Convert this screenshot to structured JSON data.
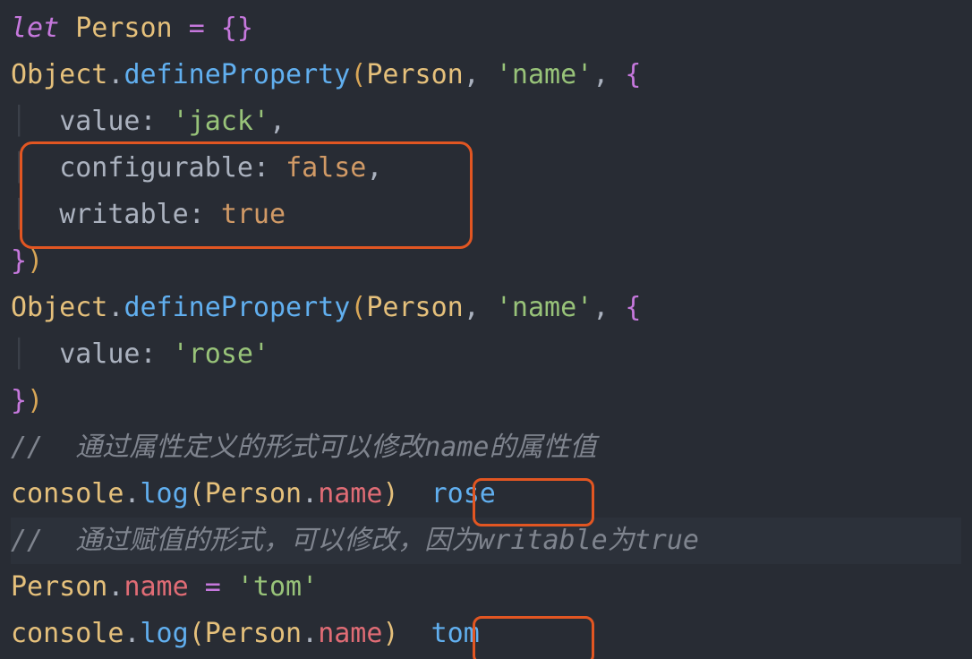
{
  "code": {
    "l1": {
      "let": "let",
      "sp1": " ",
      "Person": "Person",
      "sp2": " ",
      "eq": "=",
      "sp3": " ",
      "ob": "{}",
      "cb": ""
    },
    "l2": {
      "Object": "Object",
      "dot": ".",
      "method": "defineProperty",
      "op": "(",
      "arg1": "Person",
      "c1": ", ",
      "str": "'name'",
      "c2": ", ",
      "brace": "{"
    },
    "l3": {
      "indent": "  ",
      "key": "value",
      "colon": ": ",
      "val": "'jack'",
      "comma": ","
    },
    "l4": {
      "indent": "  ",
      "key": "configurable",
      "colon": ": ",
      "val": "false",
      "comma": ","
    },
    "l5": {
      "indent": "  ",
      "key": "writable",
      "colon": ": ",
      "val": "true"
    },
    "l6": {
      "brace": "}",
      "cp": ")"
    },
    "l7": {
      "Object": "Object",
      "dot": ".",
      "method": "defineProperty",
      "op": "(",
      "arg1": "Person",
      "c1": ", ",
      "str": "'name'",
      "c2": ", ",
      "brace": "{"
    },
    "l8": {
      "indent": "  ",
      "key": "value",
      "colon": ": ",
      "val": "'rose'"
    },
    "l9": {
      "brace": "}",
      "cp": ")"
    },
    "l10": {
      "comment": "//  通过属性定义的形式可以修改name的属性值"
    },
    "l11": {
      "obj": "console",
      "dot": ".",
      "method": "log",
      "op": "(",
      "arg": "Person",
      "dot2": ".",
      "prop": "name",
      "cp": ")",
      "gap": "  ",
      "out": "rose"
    },
    "l12": {
      "comment": "//  通过赋值的形式，可以修改，因为writable为true"
    },
    "l13": {
      "obj": "Person",
      "dot": ".",
      "prop": "name",
      "sp": " ",
      "eq": "=",
      "sp2": " ",
      "val": "'tom'"
    },
    "l14": {
      "obj": "console",
      "dot": ".",
      "method": "log",
      "op": "(",
      "arg": "Person",
      "dot2": ".",
      "prop": "name",
      "cp": ")",
      "gap": "  ",
      "out": "tom"
    }
  }
}
